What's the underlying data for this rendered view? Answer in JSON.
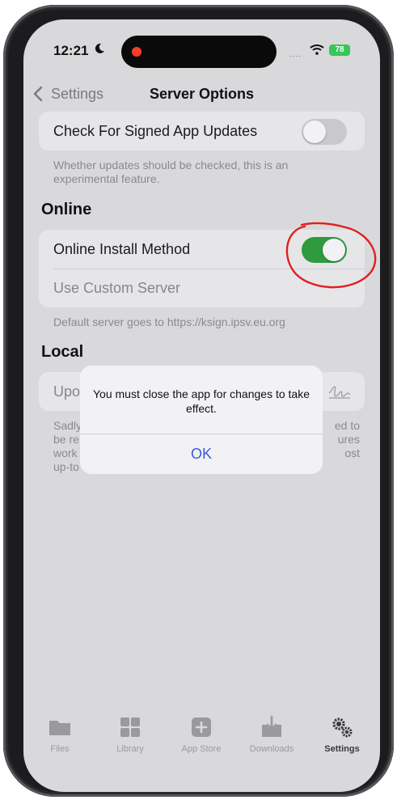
{
  "status": {
    "time": "12:21",
    "signal": "....",
    "battery": "78"
  },
  "nav": {
    "back_label": "Settings",
    "title": "Server Options"
  },
  "updates": {
    "label": "Check For Signed App Updates",
    "toggle_on": false,
    "footer_line1": "Whether updates should be checked, this is an",
    "footer_line2": "experimental feature."
  },
  "online": {
    "header": "Online",
    "install_label": "Online Install Method",
    "install_on": true,
    "custom_label": "Use Custom Server",
    "footer": "Default server goes to https://ksign.ipsv.eu.org"
  },
  "local": {
    "header": "Local",
    "row_label": "Upo",
    "footer_left": [
      "Sadly",
      "be re",
      "work",
      "up-to"
    ],
    "footer_right": [
      "ed to",
      "ures",
      "ost"
    ]
  },
  "alert": {
    "message": "You must close the app for changes to take effect.",
    "ok": "OK"
  },
  "tabs": [
    {
      "label": "Files",
      "icon": "folder-icon"
    },
    {
      "label": "Library",
      "icon": "grid-icon"
    },
    {
      "label": "App Store",
      "icon": "plus-square-icon"
    },
    {
      "label": "Downloads",
      "icon": "download-icon"
    },
    {
      "label": "Settings",
      "icon": "gears-icon",
      "active": true
    }
  ],
  "colors": {
    "toggle_on": "#2f9a3e",
    "annotation": "#e02020",
    "link": "#3a5bd9"
  }
}
